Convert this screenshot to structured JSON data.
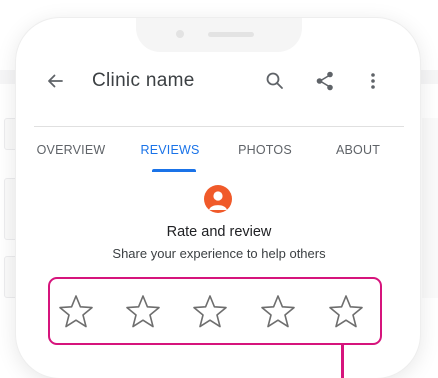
{
  "app": {
    "title": "Clinic name"
  },
  "icons": {
    "back": "arrow-back-icon",
    "search": "search-icon",
    "share": "share-icon",
    "more": "more-vert-icon",
    "avatar": "user-avatar",
    "star": "star-outline-icon"
  },
  "tabs": [
    {
      "label": "OVERVIEW",
      "active": false
    },
    {
      "label": "REVIEWS",
      "active": true
    },
    {
      "label": "PHOTOS",
      "active": false
    },
    {
      "label": "ABOUT",
      "active": false
    }
  ],
  "review": {
    "heading": "Rate and review",
    "subtitle": "Share your experience to help others",
    "rating": 0,
    "max_rating": 5
  },
  "colors": {
    "accent": "#1a73e8",
    "highlight": "#d6147c",
    "avatar": "#f05a2a",
    "text_primary": "#202124",
    "text_secondary": "#5f6368"
  }
}
